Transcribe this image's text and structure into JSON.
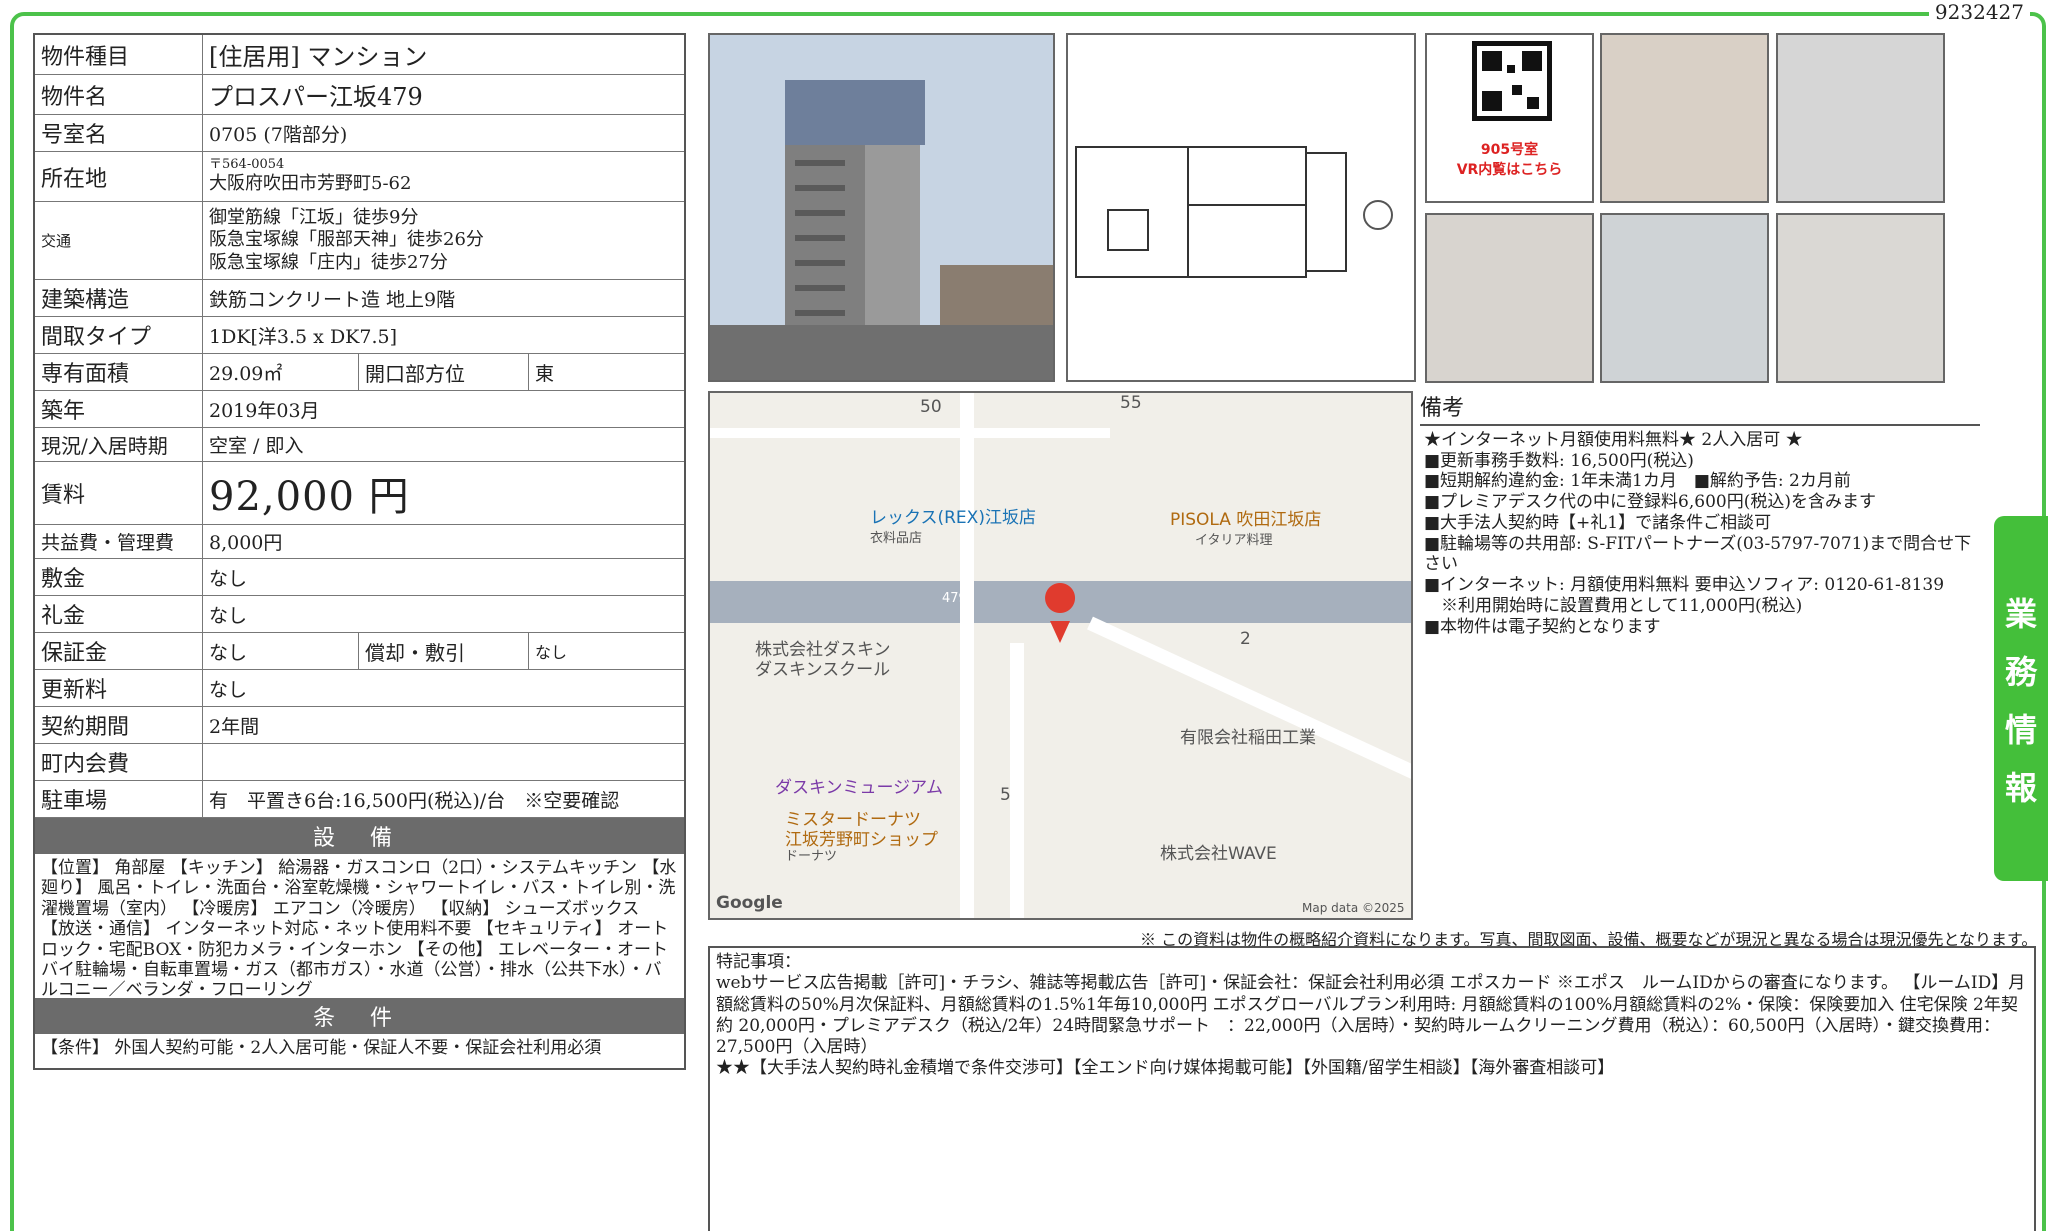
{
  "doc_id": "9232427",
  "spec": {
    "type_label": "物件種目",
    "type_value": "[住居用] マンション",
    "name_label": "物件名",
    "name_value": "プロスパー江坂479",
    "room_label": "号室名",
    "room_value": "0705 (7階部分)",
    "address_label": "所在地",
    "address_zip": "〒564-0054",
    "address_value": "大阪府吹田市芳野町5-62",
    "access_label": "交通",
    "access_lines": [
      "御堂筋線「江坂」徒歩9分",
      "阪急宝塚線「服部天神」徒歩26分",
      "阪急宝塚線「庄内」徒歩27分"
    ],
    "structure_label": "建築構造",
    "structure_value": "鉄筋コンクリート造 地上9階",
    "layout_label": "間取タイプ",
    "layout_value": "1DK[洋3.5 x DK7.5]",
    "area_label": "専有面積",
    "area_value": "29.09㎡",
    "facing_label": "開口部方位",
    "facing_value": "東",
    "built_label": "築年",
    "built_value": "2019年03月",
    "status_label": "現況/入居時期",
    "status_value": "空室 / 即入",
    "rent_label": "賃料",
    "rent_value": "92,000 円",
    "fee_label": "共益費・管理費",
    "fee_value": "8,000円",
    "deposit_label": "敷金",
    "deposit_value": "なし",
    "key_label": "礼金",
    "key_value": "なし",
    "guarantee_label": "保証金",
    "guarantee_value": "なし",
    "amort_label": "償却・敷引",
    "amort_value": "なし",
    "renewal_label": "更新料",
    "renewal_value": "なし",
    "term_label": "契約期間",
    "term_value": "2年間",
    "assoc_label": "町内会費",
    "assoc_value": "",
    "parking_label": "駐車場",
    "parking_value": "有　平置き6台:16,500円(税込)/台　※空要確認"
  },
  "equipment": {
    "title": "設 備",
    "text": "【位置】 角部屋 【キッチン】 給湯器・ガスコンロ（2口）・システムキッチン 【水廻り】 風呂・トイレ・洗面台・浴室乾燥機・シャワートイレ・バス・トイレ別・洗濯機置場（室内） 【冷暖房】 エアコン（冷暖房） 【収納】 シューズボックス 【放送・通信】 インターネット対応・ネット使用料不要 【セキュリティ】 オートロック・宅配BOX・防犯カメラ・インターホン 【その他】 エレベーター・オートバイ駐輪場・自転車置場・ガス（都市ガス）・水道（公営）・排水（公共下水）・バルコニー／ベランダ・フローリング"
  },
  "conditions": {
    "title": "条 件",
    "text": "【条件】 外国人契約可能・2人入居可能・保証人不要・保証会社利用必須"
  },
  "qr": {
    "room": "905号室",
    "caption": "VR内覧はこちら"
  },
  "map": {
    "labels": [
      "50",
      "55",
      "レックス(REX)江坂店",
      "衣料品店",
      "PISOLA 吹田江坂店",
      "イタリア料理",
      "479",
      "株式会社ダスキン",
      "ダスキンスクール",
      "2",
      "有限会社稲田工業",
      "ダスキンミュージアム",
      "5",
      "ミスタードーナツ",
      "江坂芳野町ショップ",
      "ドーナツ",
      "株式会社WAVE",
      "Google",
      "Map data ©2025"
    ]
  },
  "notes": {
    "title": "備考",
    "lines": [
      "★インターネット月額使用料無料★ 2人入居可 ★",
      "■更新事務手数料: 16,500円(税込)",
      "■短期解約違約金: 1年未満1カ月　■解約予告: 2カ月前",
      "■プレミアデスク代の中に登録料6,600円(税込)を含みます",
      "■大手法人契約時【+礼1】で諸条件ご相談可",
      "■駐輪場等の共用部: S-FITパートナーズ(03-5797-7071)まで問合せ下さい",
      "■インターネット: 月額使用料無料 要申込ソフィア: 0120-61-8139",
      "　※利用開始時に設置費用として11,000円(税込)",
      "■本物件は電子契約となります"
    ]
  },
  "disclaimer": "※ この資料は物件の概略紹介資料になります。写真、間取図面、設備、概要などが現況と異なる場合は現況優先となります。",
  "remarks": {
    "title": "特記事項：",
    "text": "webサービス広告掲載［許可]・チラシ、雑誌等掲載広告［許可]・保証会社：保証会社利用必須 エポスカード ※エポス　ルームIDからの審査になります。 【ルームID】月額総賃料の50%月次保証料、月額総賃料の1.5%1年毎10,000円 エポスグローバルプラン利用時: 月額総賃料の100%月額総賃料の2%・保険：保険要加入 住宅保険 2年契約 20,000円・プレミアデスク（税込/2年）24時間緊急サポート　：22,000円（入居時）・契約時ルームクリーニング費用（税込）：60,500円（入居時）・鍵交換費用：27,500円（入居時）",
    "text2": "★★【大手法人契約時礼金積増で条件交渉可】【全エンド向け媒体掲載可能】【外国籍/留学生相談】【海外審査相談可】"
  },
  "side_tab": [
    "業",
    "務",
    "情",
    "報"
  ]
}
